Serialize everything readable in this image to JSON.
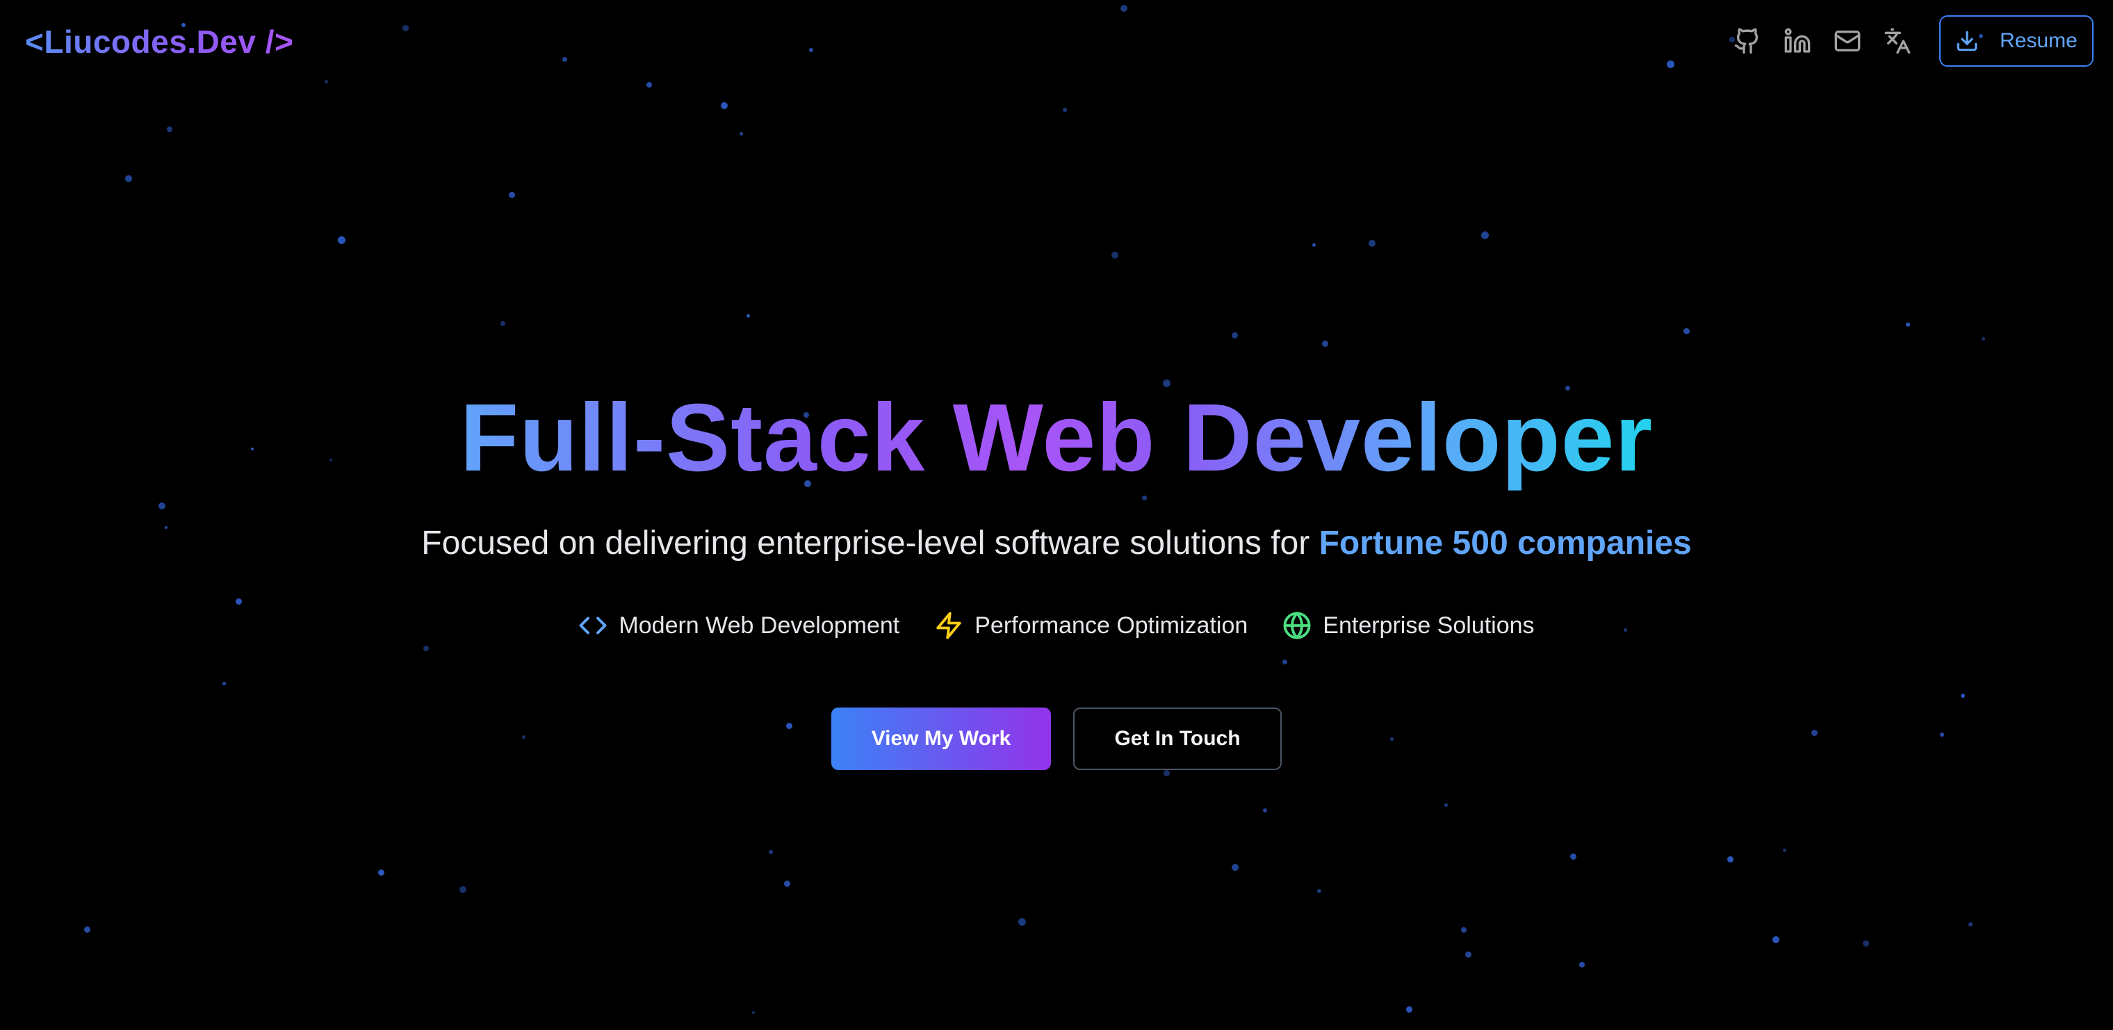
{
  "header": {
    "logo": "<Liucodes.Dev />",
    "icons": [
      "github-icon",
      "linkedin-icon",
      "mail-icon",
      "translate-icon"
    ],
    "resume_label": "Resume"
  },
  "hero": {
    "title": "Full-Stack Web Developer",
    "subtitle_prefix": "Focused on delivering enterprise-level software solutions for",
    "subtitle_highlight": "Fortune 500 companies",
    "features": [
      {
        "icon": "code-icon",
        "label": "Modern Web Development",
        "color": "#60a5fa"
      },
      {
        "icon": "lightning-icon",
        "label": "Performance Optimization",
        "color": "#facc15"
      },
      {
        "icon": "globe-icon",
        "label": "Enterprise Solutions",
        "color": "#4ade80"
      }
    ],
    "primary_button": "View My Work",
    "secondary_button": "Get In Touch"
  },
  "colors": {
    "background": "#000000",
    "accent_blue": "#3b82f6",
    "accent_purple": "#9333ea",
    "accent_cyan": "#22d3ee",
    "star": "#2f5fd0"
  }
}
